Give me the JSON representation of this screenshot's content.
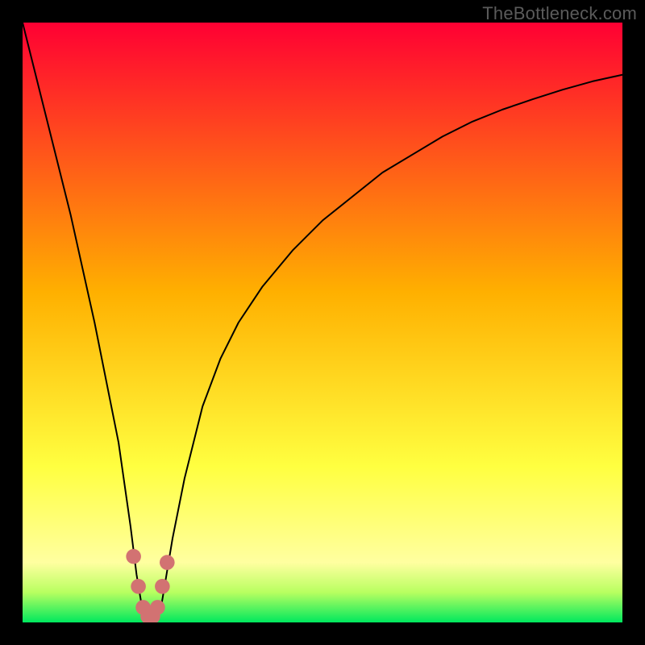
{
  "watermark": "TheBottleneck.com",
  "icons": {},
  "colors": {
    "frame": "#000000",
    "gradient_top": "#ff0033",
    "gradient_mid": "#ffd500",
    "gradient_low": "#ffff7a",
    "gradient_bottom": "#00e85e",
    "curve": "#000000",
    "marker": "#d27272",
    "watermark": "#5b5b5b"
  },
  "chart_data": {
    "type": "line",
    "title": "",
    "xlabel": "",
    "ylabel": "",
    "xlim": [
      0,
      100
    ],
    "ylim": [
      0,
      100
    ],
    "note": "x = normalized horizontal position (0–100), y = bottleneck % (0 = ideal match at green zone, 100 = severe bottleneck)",
    "curve": {
      "x": [
        0,
        2,
        5,
        8,
        10,
        12,
        14,
        16,
        18,
        19,
        20,
        21,
        22,
        23,
        24,
        25,
        27,
        30,
        33,
        36,
        40,
        45,
        50,
        55,
        60,
        65,
        70,
        75,
        80,
        85,
        90,
        95,
        100
      ],
      "y": [
        100,
        92,
        80,
        68,
        59,
        50,
        40,
        30,
        16,
        8,
        2,
        0,
        0,
        2,
        8,
        14,
        24,
        36,
        44,
        50,
        56,
        62,
        67,
        71,
        75,
        78,
        81,
        83.5,
        85.5,
        87.2,
        88.8,
        90.2,
        91.3
      ]
    },
    "markers": {
      "x": [
        18.5,
        19.3,
        20.1,
        20.9,
        21.7,
        22.5,
        23.3,
        24.1
      ],
      "y": [
        11,
        6,
        2.5,
        1,
        1,
        2.5,
        6,
        10
      ]
    },
    "gradient_stops_pct": {
      "0": "#ff0033",
      "45": "#ffb000",
      "74": "#ffff40",
      "90": "#ffffa0",
      "95": "#b8ff60",
      "100": "#00e85e"
    }
  }
}
